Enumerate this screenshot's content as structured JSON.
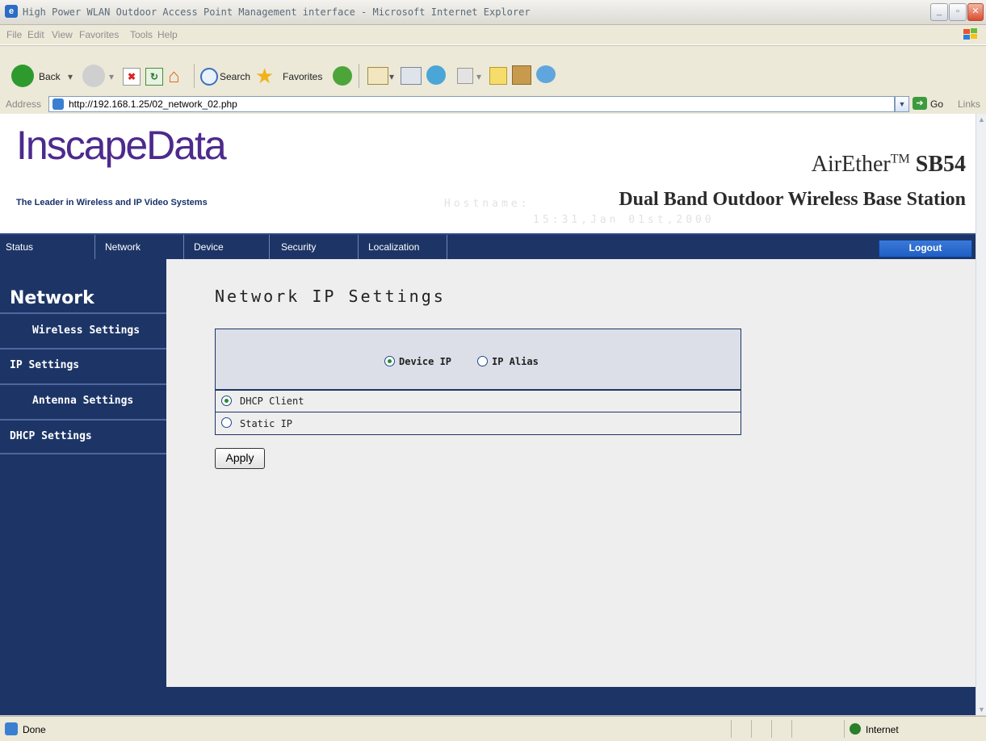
{
  "window": {
    "title": "High Power WLAN Outdoor Access Point Management interface - Microsoft Internet Explorer"
  },
  "menu": [
    "File",
    "Edit",
    "View",
    "Favorites",
    "Tools",
    "Help"
  ],
  "toolbar": {
    "back_label": "Back",
    "search_label": "Search",
    "favorites_label": "Favorites"
  },
  "address": {
    "label": "Address",
    "url": "http://192.168.1.25/02_network_02.php",
    "go_label": "Go",
    "links_label": "Links"
  },
  "header": {
    "logo": "InscapeData",
    "tagline": "The Leader in Wireless and IP Video Systems",
    "hostname": "Hostname:",
    "datetime": "15:31,Jan 01st,2000",
    "product": "AirEther",
    "product_tm": "TM",
    "product_model": "SB54",
    "subtitle": "Dual Band Outdoor Wireless Base Station"
  },
  "nav": {
    "items": [
      "Status",
      "Network",
      "Device",
      "Security",
      "Localization"
    ],
    "logout": "Logout"
  },
  "sidebar": {
    "title": "Network",
    "items": [
      "Wireless Settings",
      "IP Settings",
      "Antenna Settings",
      "DHCP Settings"
    ]
  },
  "content": {
    "heading": "Network IP Settings",
    "mode_options": [
      {
        "label": "Device IP",
        "selected": true
      },
      {
        "label": "IP Alias",
        "selected": false
      }
    ],
    "ip_options": [
      {
        "label": "DHCP Client",
        "selected": true
      },
      {
        "label": "Static IP",
        "selected": false
      }
    ],
    "apply_label": "Apply"
  },
  "status": {
    "text": "Done",
    "zone": "Internet"
  },
  "colors": {
    "nav_bg": "#1d3566",
    "logo": "#4d2a8c",
    "logout_bg": "#2a6ad0"
  }
}
